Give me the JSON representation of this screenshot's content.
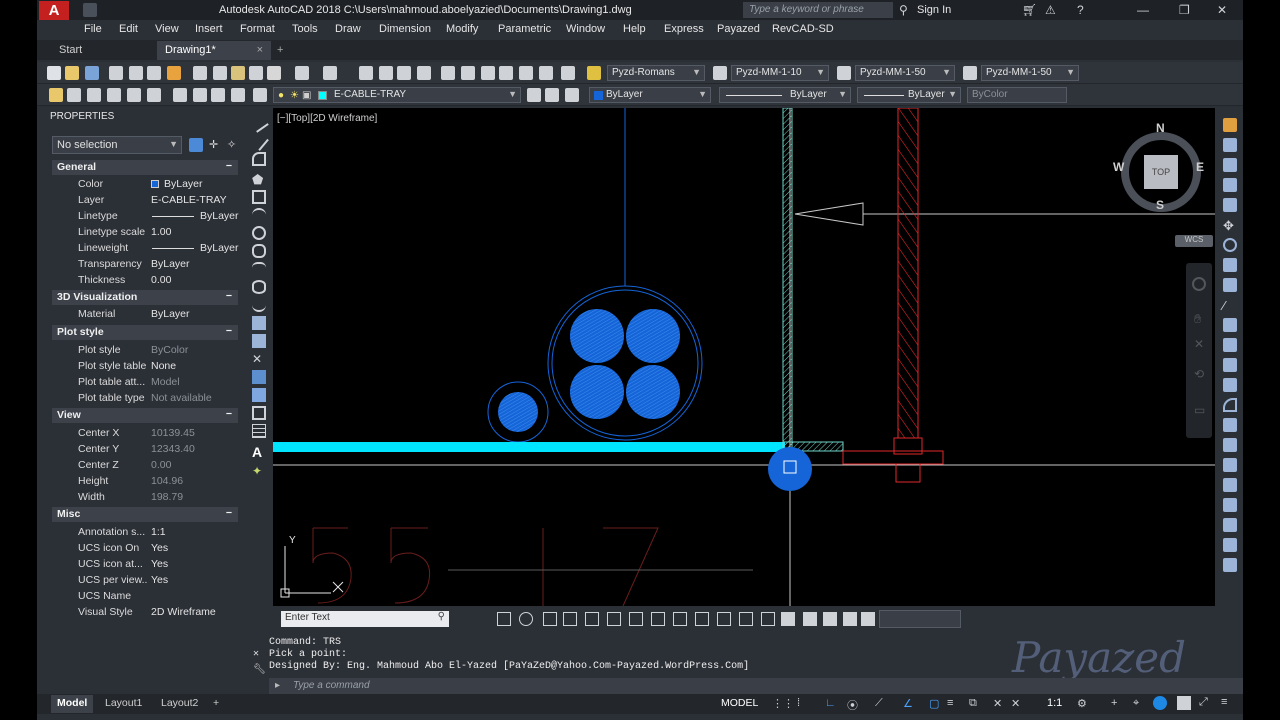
{
  "app": {
    "title": "Autodesk AutoCAD 2018    C:\\Users\\mahmoud.aboelyazied\\Documents\\Drawing1.dwg",
    "search_placeholder": "Type a keyword or phrase",
    "sign_in": "Sign In"
  },
  "menu": [
    "File",
    "Edit",
    "View",
    "Insert",
    "Format",
    "Tools",
    "Draw",
    "Dimension",
    "Modify",
    "Parametric",
    "Window",
    "Help",
    "Express",
    "Payazed",
    "RevCAD-SD"
  ],
  "tabs": {
    "start": "Start",
    "drawing": "Drawing1*",
    "close": "×",
    "new": "+"
  },
  "toolbar": {
    "text_style": "Pyzd-Romans",
    "dim_style": "Pyzd-MM-1-10",
    "table_style": "Pyzd-MM-1-50",
    "mleader_style": "Pyzd-MM-1-50",
    "layer": "E-CABLE-TRAY",
    "color": "ByLayer",
    "linetype": "ByLayer",
    "lineweight": "ByLayer",
    "plotstyle": "ByColor"
  },
  "properties": {
    "title": "PROPERTIES",
    "selection": "No selection",
    "general": {
      "header": "General",
      "rows": [
        {
          "k": "Color",
          "v": "ByLayer"
        },
        {
          "k": "Layer",
          "v": "E-CABLE-TRAY"
        },
        {
          "k": "Linetype",
          "v": "ByLayer"
        },
        {
          "k": "Linetype scale",
          "v": "1.00"
        },
        {
          "k": "Lineweight",
          "v": "ByLayer"
        },
        {
          "k": "Transparency",
          "v": "ByLayer"
        },
        {
          "k": "Thickness",
          "v": "0.00"
        }
      ]
    },
    "viz": {
      "header": "3D Visualization",
      "rows": [
        {
          "k": "Material",
          "v": "ByLayer"
        }
      ]
    },
    "plot": {
      "header": "Plot style",
      "rows": [
        {
          "k": "Plot style",
          "v": "ByColor"
        },
        {
          "k": "Plot style table",
          "v": "None"
        },
        {
          "k": "Plot table att...",
          "v": "Model"
        },
        {
          "k": "Plot table type",
          "v": "Not available"
        }
      ]
    },
    "view": {
      "header": "View",
      "rows": [
        {
          "k": "Center X",
          "v": "10139.45"
        },
        {
          "k": "Center Y",
          "v": "12343.40"
        },
        {
          "k": "Center Z",
          "v": "0.00"
        },
        {
          "k": "Height",
          "v": "104.96"
        },
        {
          "k": "Width",
          "v": "198.79"
        }
      ]
    },
    "misc": {
      "header": "Misc",
      "rows": [
        {
          "k": "Annotation s...",
          "v": "1:1"
        },
        {
          "k": "UCS icon On",
          "v": "Yes"
        },
        {
          "k": "UCS icon at...",
          "v": "Yes"
        },
        {
          "k": "UCS per view...",
          "v": "Yes"
        },
        {
          "k": "UCS Name",
          "v": ""
        },
        {
          "k": "Visual Style",
          "v": "2D Wireframe"
        }
      ]
    },
    "collapse": "−"
  },
  "viewport": {
    "label": "[−][Top][2D Wireframe]",
    "cube": {
      "n": "N",
      "s": "S",
      "e": "E",
      "w": "W",
      "top": "TOP",
      "wcs": "WCS"
    },
    "ucs": {
      "y": "Y",
      "x": "X"
    },
    "bg_text": "55 — 17"
  },
  "status": {
    "enter_text": "Enter Text"
  },
  "command": {
    "line1": "Command: TRS",
    "line2": "Pick a point:",
    "line3": "Designed By: Eng. Mahmoud Abo El-Yazed [PaYaZeD@Yahoo.Com-Payazed.WordPress.Com]",
    "placeholder": "Type a command"
  },
  "watermark": "Payazed",
  "layouts": {
    "model": "Model",
    "layout1": "Layout1",
    "layout2": "Layout2",
    "add": "+"
  },
  "model_indicator": "MODEL",
  "scale": "1:1",
  "colors": {
    "cyan": "#00e5ff",
    "blue": "#1565d8",
    "red": "#e0282a",
    "hatch": "#6fd3c9"
  }
}
